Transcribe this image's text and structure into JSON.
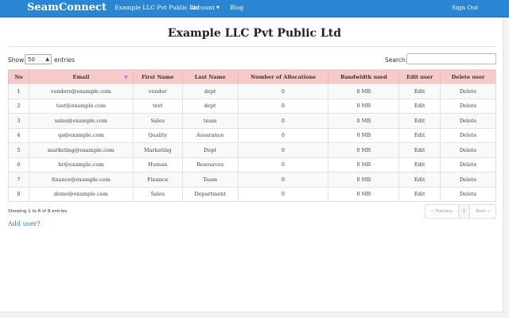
{
  "nav": {
    "brand": "SeamConnect",
    "company": "Example LLC Pvt Public Ltd",
    "account": "Account",
    "blog": "Blog",
    "signout": "Sign Out"
  },
  "page": {
    "title": "Example LLC Pvt Public Ltd"
  },
  "controls": {
    "show_label": "Show",
    "entries_label": "entries",
    "page_size": "50",
    "search_label": "Search:",
    "search_value": ""
  },
  "table": {
    "headers": [
      "No",
      "Email",
      "First Name",
      "Last Name",
      "Number of Allocations",
      "Bandwidth used",
      "Edit user",
      "Delete user"
    ],
    "rows": [
      {
        "no": "1",
        "email": "vendors@example.com",
        "first": "vendor",
        "last": "dept",
        "alloc": "0",
        "bw": "0 MB",
        "edit": "Edit",
        "delete": "Delete"
      },
      {
        "no": "2",
        "email": "test@example.com",
        "first": "test",
        "last": "dept",
        "alloc": "0",
        "bw": "0 MB",
        "edit": "Edit",
        "delete": "Delete"
      },
      {
        "no": "3",
        "email": "sales@example.com",
        "first": "Sales",
        "last": "team",
        "alloc": "0",
        "bw": "0 MB",
        "edit": "Edit",
        "delete": "Delete"
      },
      {
        "no": "4",
        "email": "qs@example.com",
        "first": "Quality",
        "last": "Assurance",
        "alloc": "0",
        "bw": "0 MB",
        "edit": "Edit",
        "delete": "Delete"
      },
      {
        "no": "5",
        "email": "marketing@example.com",
        "first": "Marketing",
        "last": "Dept",
        "alloc": "0",
        "bw": "0 MB",
        "edit": "Edit",
        "delete": "Delete"
      },
      {
        "no": "6",
        "email": "hr@example.com",
        "first": "Human",
        "last": "Resources",
        "alloc": "0",
        "bw": "0 MB",
        "edit": "Edit",
        "delete": "Delete"
      },
      {
        "no": "7",
        "email": "finance@example.com",
        "first": "Finance",
        "last": "Team",
        "alloc": "0",
        "bw": "0 MB",
        "edit": "Edit",
        "delete": "Delete"
      },
      {
        "no": "8",
        "email": "demo@example.com",
        "first": "Sales",
        "last": "Department",
        "alloc": "0",
        "bw": "0 MB",
        "edit": "Edit",
        "delete": "Delete"
      }
    ]
  },
  "footer": {
    "info": "Showing 1 to 8 of 8 entries",
    "prev": "← Previous",
    "page": "1",
    "next": "Next →",
    "add_user": "Add user?"
  },
  "colors": {
    "navbar": "#2a86d2",
    "header_row": "#f8c9c9",
    "link": "#2a86d2"
  }
}
